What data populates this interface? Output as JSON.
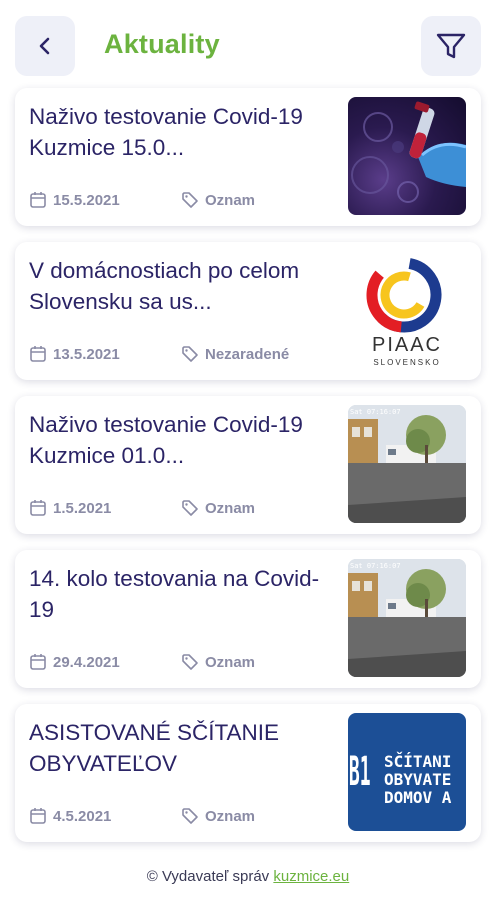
{
  "header": {
    "title": "Aktuality",
    "back_icon": "chevron-left-icon",
    "filter_icon": "filter-icon"
  },
  "articles": [
    {
      "title": "Naživo testovanie Covid-19 Kuzmice 15.0...",
      "date": "15.5.2021",
      "tag": "Oznam",
      "thumb": "covid-test-tube-image"
    },
    {
      "title": "V domácnostiach po celom Slovensku sa us...",
      "date": "13.5.2021",
      "tag": "Nezaradené",
      "thumb": "piaac-logo-image",
      "thumb_text": "PIAAC",
      "thumb_sub": "SLOVENSKO"
    },
    {
      "title": "Naživo testovanie Covid-19 Kuzmice 01.0...",
      "date": "1.5.2021",
      "tag": "Oznam",
      "thumb": "camera-snapshot-image",
      "thumb_text": "Sat 07:16:07"
    },
    {
      "title": "14. kolo testovania na Covid-19",
      "date": "29.4.2021",
      "tag": "Oznam",
      "thumb": "camera-snapshot-image",
      "thumb_text": "Sat 07:16:07"
    },
    {
      "title": "ASISTOVANÉ SČÍTANIE OBYVATEĽOV",
      "date": "4.5.2021",
      "tag": "Oznam",
      "thumb": "scitanie-banner-image",
      "thumb_num": "B1",
      "thumb_lines": [
        "SČÍTANI",
        "OBYVATE",
        "DOMOV A"
      ]
    }
  ],
  "footer": {
    "prefix": "© Vydavateľ správ",
    "link": "kuzmice.eu"
  },
  "colors": {
    "accent": "#6cb33f",
    "title_text": "#2b2466",
    "meta_text": "#8a8ba5",
    "button_bg": "#eef0f8"
  }
}
